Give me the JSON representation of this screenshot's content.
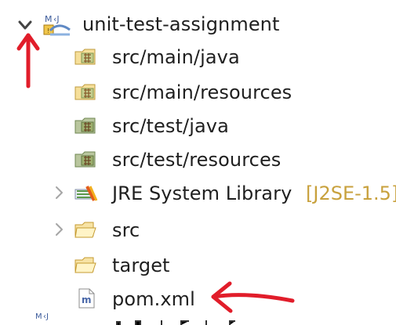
{
  "tree": {
    "project": {
      "label": "unit-test-assignment",
      "icon": "maven-project-icon",
      "expanded": true
    },
    "items": [
      {
        "label": "src/main/java",
        "icon": "source-folder-icon",
        "expanded": false
      },
      {
        "label": "src/main/resources",
        "icon": "source-folder-icon",
        "expanded": false
      },
      {
        "label": "src/test/java",
        "icon": "source-folder-icon",
        "expanded": false
      },
      {
        "label": "src/test/resources",
        "icon": "source-folder-icon",
        "expanded": false
      },
      {
        "label": "JRE System Library",
        "decoration": "[J2SE-1.5]",
        "icon": "library-icon",
        "expanded": false
      },
      {
        "label": "src",
        "icon": "folder-icon",
        "expanded": false
      },
      {
        "label": "target",
        "icon": "folder-icon",
        "expanded": false
      },
      {
        "label": "pom.xml",
        "icon": "maven-file-icon",
        "expanded": false
      }
    ]
  },
  "colors": {
    "text": "#1f1f1f",
    "decoration": "#c8a13d",
    "annotation_red": "#e11d2a",
    "folder_yellow": "#f2d27b",
    "source_green": "#8aa66a"
  }
}
